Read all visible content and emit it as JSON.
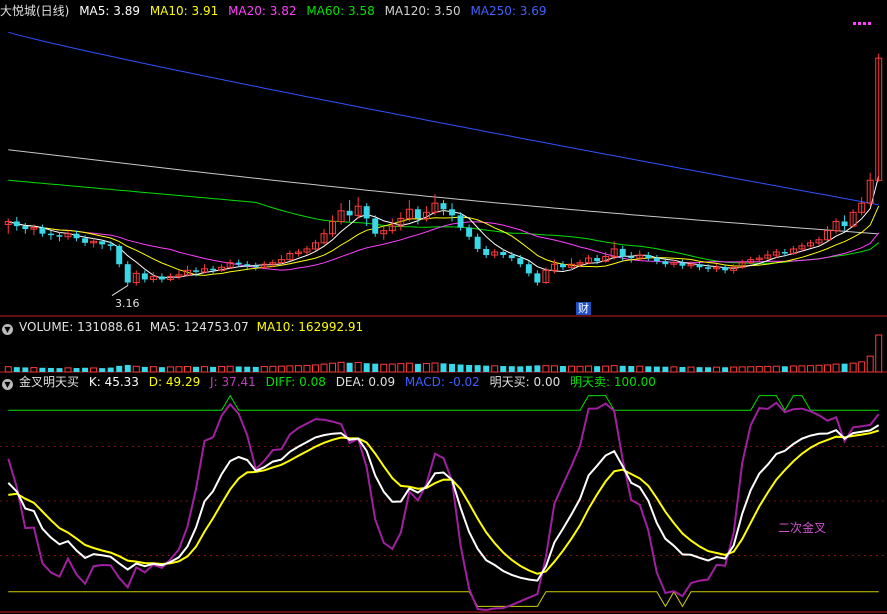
{
  "header_price": {
    "title": "大悦城(日线)",
    "ma5": "MA5: 3.89",
    "ma10": "MA10: 3.91",
    "ma20": "MA20: 3.82",
    "ma60": "MA60: 3.58",
    "ma120": "MA120: 3.50",
    "ma250": "MA250: 3.69"
  },
  "header_volume": {
    "volume": "VOLUME: 131088.61",
    "ma5": "MA5: 124753.07",
    "ma10": "MA10: 162992.91"
  },
  "header_indicator": {
    "name": "金叉明天买",
    "k": "K: 45.33",
    "d": "D: 49.29",
    "j": "J: 37.41",
    "diff": "DIFF: 0.08",
    "dea": "DEA: 0.09",
    "macd": "MACD: -0.02",
    "buy": "明天买: 0.00",
    "sell": "明天卖: 100.00"
  },
  "annotations": {
    "low_label": "3.16",
    "event_marker": "财",
    "cross_label": "二次金叉"
  },
  "colors": {
    "up": "#ff3a3a",
    "down": "#38d8e8",
    "ma5": "#ffffff",
    "ma10": "#ffff00",
    "ma20": "#ff40ff",
    "ma60": "#00e000",
    "ma120": "#c8c8c8",
    "ma250": "#3050ff",
    "j_line": "#a020a0"
  },
  "chart_data": {
    "type": "candlestick",
    "price_range": [
      3.0,
      4.9
    ],
    "candles": [
      [
        3.56,
        3.58,
        3.5,
        3.6
      ],
      [
        3.58,
        3.55,
        3.52,
        3.61
      ],
      [
        3.55,
        3.53,
        3.5,
        3.57
      ],
      [
        3.53,
        3.54,
        3.49,
        3.56
      ],
      [
        3.54,
        3.5,
        3.48,
        3.56
      ],
      [
        3.5,
        3.49,
        3.46,
        3.52
      ],
      [
        3.49,
        3.48,
        3.45,
        3.51
      ],
      [
        3.48,
        3.5,
        3.46,
        3.52
      ],
      [
        3.5,
        3.47,
        3.45,
        3.52
      ],
      [
        3.47,
        3.44,
        3.42,
        3.49
      ],
      [
        3.44,
        3.45,
        3.41,
        3.47
      ],
      [
        3.45,
        3.43,
        3.4,
        3.46
      ],
      [
        3.43,
        3.42,
        3.39,
        3.45
      ],
      [
        3.42,
        3.3,
        3.28,
        3.43
      ],
      [
        3.3,
        3.18,
        3.16,
        3.32
      ],
      [
        3.18,
        3.24,
        3.16,
        3.26
      ],
      [
        3.24,
        3.2,
        3.18,
        3.26
      ],
      [
        3.2,
        3.22,
        3.18,
        3.25
      ],
      [
        3.22,
        3.2,
        3.18,
        3.24
      ],
      [
        3.2,
        3.22,
        3.19,
        3.24
      ],
      [
        3.22,
        3.23,
        3.2,
        3.26
      ],
      [
        3.23,
        3.26,
        3.22,
        3.29
      ],
      [
        3.26,
        3.25,
        3.22,
        3.28
      ],
      [
        3.25,
        3.27,
        3.24,
        3.3
      ],
      [
        3.27,
        3.26,
        3.24,
        3.29
      ],
      [
        3.26,
        3.28,
        3.25,
        3.3
      ],
      [
        3.28,
        3.31,
        3.27,
        3.33
      ],
      [
        3.31,
        3.3,
        3.28,
        3.33
      ],
      [
        3.3,
        3.29,
        3.26,
        3.32
      ],
      [
        3.29,
        3.28,
        3.26,
        3.31
      ],
      [
        3.28,
        3.3,
        3.27,
        3.32
      ],
      [
        3.3,
        3.31,
        3.28,
        3.33
      ],
      [
        3.31,
        3.33,
        3.3,
        3.36
      ],
      [
        3.33,
        3.37,
        3.32,
        3.39
      ],
      [
        3.37,
        3.38,
        3.35,
        3.4
      ],
      [
        3.38,
        3.4,
        3.36,
        3.42
      ],
      [
        3.4,
        3.44,
        3.39,
        3.46
      ],
      [
        3.44,
        3.5,
        3.43,
        3.53
      ],
      [
        3.5,
        3.58,
        3.48,
        3.62
      ],
      [
        3.58,
        3.65,
        3.56,
        3.7
      ],
      [
        3.65,
        3.62,
        3.58,
        3.72
      ],
      [
        3.62,
        3.68,
        3.6,
        3.74
      ],
      [
        3.68,
        3.6,
        3.55,
        3.7
      ],
      [
        3.6,
        3.5,
        3.48,
        3.62
      ],
      [
        3.5,
        3.52,
        3.46,
        3.55
      ],
      [
        3.52,
        3.55,
        3.5,
        3.6
      ],
      [
        3.55,
        3.6,
        3.52,
        3.64
      ],
      [
        3.6,
        3.66,
        3.58,
        3.72
      ],
      [
        3.66,
        3.6,
        3.56,
        3.68
      ],
      [
        3.6,
        3.64,
        3.58,
        3.68
      ],
      [
        3.64,
        3.7,
        3.62,
        3.76
      ],
      [
        3.7,
        3.66,
        3.62,
        3.72
      ],
      [
        3.66,
        3.62,
        3.58,
        3.7
      ],
      [
        3.62,
        3.54,
        3.52,
        3.64
      ],
      [
        3.54,
        3.48,
        3.46,
        3.56
      ],
      [
        3.48,
        3.4,
        3.38,
        3.5
      ],
      [
        3.4,
        3.36,
        3.34,
        3.42
      ],
      [
        3.36,
        3.38,
        3.34,
        3.4
      ],
      [
        3.38,
        3.36,
        3.34,
        3.4
      ],
      [
        3.36,
        3.34,
        3.32,
        3.38
      ],
      [
        3.34,
        3.3,
        3.28,
        3.36
      ],
      [
        3.3,
        3.24,
        3.22,
        3.32
      ],
      [
        3.24,
        3.18,
        3.16,
        3.26
      ],
      [
        3.18,
        3.26,
        3.17,
        3.28
      ],
      [
        3.26,
        3.3,
        3.24,
        3.33
      ],
      [
        3.3,
        3.28,
        3.26,
        3.32
      ],
      [
        3.28,
        3.3,
        3.26,
        3.34
      ],
      [
        3.3,
        3.31,
        3.28,
        3.33
      ],
      [
        3.31,
        3.34,
        3.3,
        3.36
      ],
      [
        3.34,
        3.32,
        3.3,
        3.36
      ],
      [
        3.32,
        3.35,
        3.31,
        3.38
      ],
      [
        3.35,
        3.4,
        3.33,
        3.45
      ],
      [
        3.4,
        3.35,
        3.32,
        3.42
      ],
      [
        3.35,
        3.34,
        3.31,
        3.38
      ],
      [
        3.34,
        3.36,
        3.32,
        3.39
      ],
      [
        3.36,
        3.34,
        3.32,
        3.38
      ],
      [
        3.34,
        3.32,
        3.3,
        3.36
      ],
      [
        3.32,
        3.3,
        3.28,
        3.34
      ],
      [
        3.3,
        3.31,
        3.28,
        3.33
      ],
      [
        3.31,
        3.29,
        3.27,
        3.33
      ],
      [
        3.29,
        3.3,
        3.27,
        3.32
      ],
      [
        3.3,
        3.28,
        3.26,
        3.32
      ],
      [
        3.28,
        3.27,
        3.25,
        3.3
      ],
      [
        3.27,
        3.28,
        3.25,
        3.3
      ],
      [
        3.28,
        3.26,
        3.24,
        3.3
      ],
      [
        3.26,
        3.28,
        3.24,
        3.3
      ],
      [
        3.28,
        3.31,
        3.27,
        3.33
      ],
      [
        3.31,
        3.33,
        3.3,
        3.35
      ],
      [
        3.33,
        3.34,
        3.31,
        3.36
      ],
      [
        3.34,
        3.36,
        3.33,
        3.39
      ],
      [
        3.36,
        3.38,
        3.34,
        3.4
      ],
      [
        3.38,
        3.37,
        3.35,
        3.4
      ],
      [
        3.37,
        3.4,
        3.36,
        3.42
      ],
      [
        3.4,
        3.42,
        3.38,
        3.44
      ],
      [
        3.42,
        3.44,
        3.41,
        3.46
      ],
      [
        3.44,
        3.46,
        3.42,
        3.48
      ],
      [
        3.46,
        3.52,
        3.45,
        3.55
      ],
      [
        3.52,
        3.58,
        3.5,
        3.6
      ],
      [
        3.58,
        3.55,
        3.52,
        3.62
      ],
      [
        3.55,
        3.64,
        3.54,
        3.66
      ],
      [
        3.64,
        3.7,
        3.62,
        3.74
      ],
      [
        3.7,
        3.85,
        3.68,
        3.9
      ],
      [
        3.85,
        4.65,
        3.84,
        4.68
      ]
    ],
    "volume_range": [
      0,
      420000
    ],
    "volume": [
      60000,
      55000,
      52000,
      50000,
      48000,
      46000,
      44000,
      47000,
      45000,
      48000,
      46000,
      44000,
      50000,
      70000,
      80000,
      65000,
      58000,
      60000,
      55000,
      58000,
      60000,
      62000,
      59000,
      61000,
      58000,
      62000,
      65000,
      63000,
      60000,
      58000,
      62000,
      64000,
      66000,
      70000,
      72000,
      75000,
      80000,
      90000,
      100000,
      110000,
      105000,
      108000,
      100000,
      95000,
      88000,
      90000,
      95000,
      100000,
      92000,
      96000,
      102000,
      98000,
      92000,
      85000,
      80000,
      78000,
      72000,
      70000,
      68000,
      66000,
      64000,
      70000,
      75000,
      72000,
      70000,
      68000,
      66000,
      65000,
      68000,
      66000,
      67000,
      72000,
      70000,
      68000,
      66000,
      64000,
      62000,
      60000,
      58000,
      57000,
      56000,
      55000,
      54000,
      55000,
      54000,
      56000,
      58000,
      60000,
      62000,
      64000,
      66000,
      65000,
      68000,
      70000,
      72000,
      76000,
      80000,
      90000,
      95000,
      100000,
      115000,
      180000,
      420000
    ],
    "indicator_range": [
      -10,
      110
    ],
    "indicator_levels": [
      100,
      0
    ]
  }
}
